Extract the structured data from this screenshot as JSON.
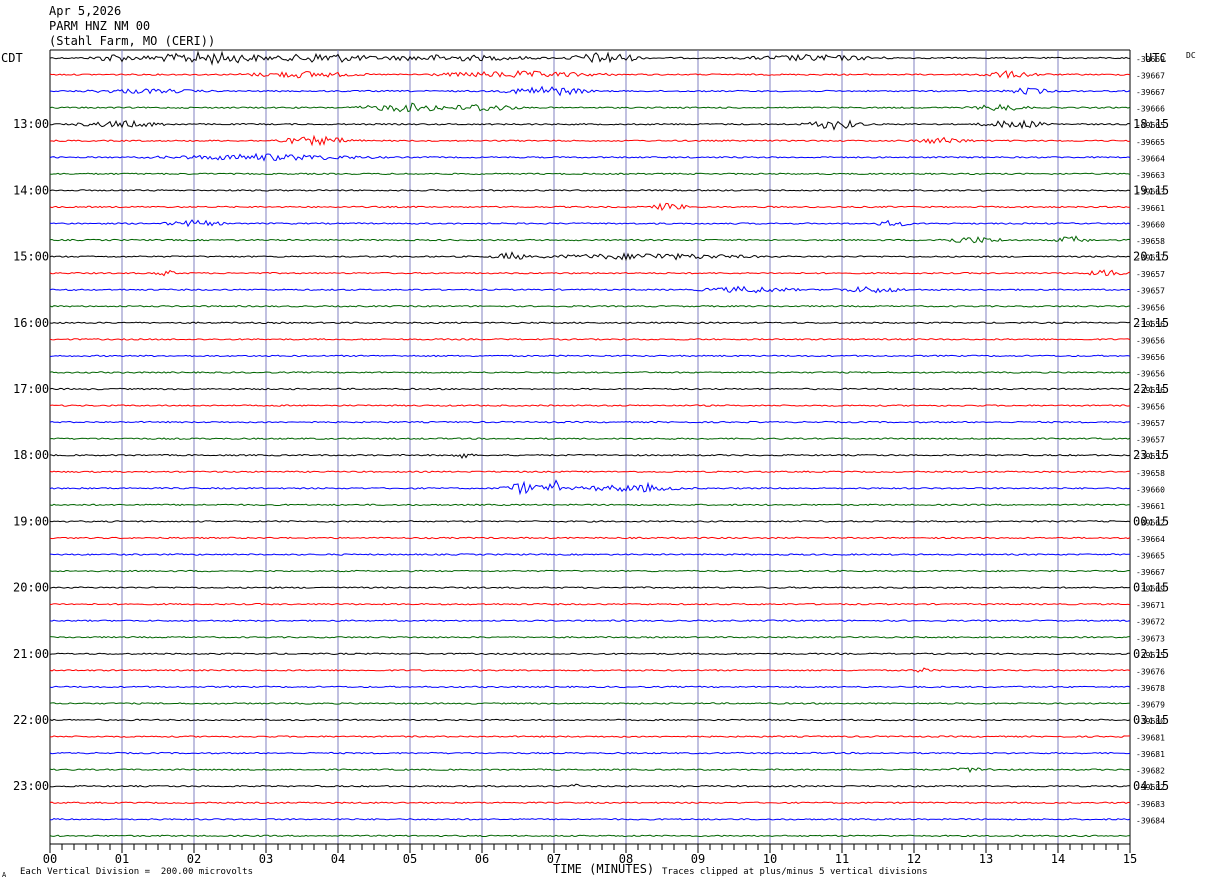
{
  "header": {
    "date": "Apr 5,2026",
    "station": "PARM HNZ NM 00",
    "location": "(Stahl Farm, MO (CERI))"
  },
  "chart_data": {
    "type": "line",
    "title": "PARM HNZ NM 00",
    "subtitle": "(Stahl Farm, MO (CERI))",
    "date": "Apr 5,2026",
    "left_timezone": "CDT",
    "right_timezone": "UTC",
    "dc_label": "DC",
    "xlabel": "TIME (MINUTES)",
    "x_ticks": [
      "00",
      "01",
      "02",
      "03",
      "04",
      "05",
      "06",
      "07",
      "08",
      "09",
      "10",
      "11",
      "12",
      "13",
      "14",
      "15"
    ],
    "xlim": [
      0,
      15
    ],
    "row_minutes": 15,
    "trace_count": 48,
    "left_hour_labels": [
      "13:00",
      "14:00",
      "15:00",
      "16:00",
      "17:00",
      "18:00",
      "19:00",
      "20:00",
      "21:00",
      "22:00",
      "23:00"
    ],
    "right_hour_labels": [
      "18:15",
      "19:15",
      "20:15",
      "21:15",
      "22:15",
      "23:15",
      "00:15",
      "01:15",
      "02:15",
      "03:15",
      "04:15"
    ],
    "trace_colors": [
      "#000000",
      "#ff0000",
      "#0000ff",
      "#006400"
    ],
    "grid_color": "#8080c0",
    "dc_offsets": [
      "-39669",
      "-39667",
      "-39667",
      "-39666",
      "-39665",
      "-39665",
      "-39664",
      "-39663",
      "-39663",
      "-39661",
      "-39660",
      "-39658",
      "-39657",
      "-39657",
      "-39657",
      "-39656",
      "-39656",
      "-39656",
      "-39656",
      "-39656",
      "-39656",
      "-39656",
      "-39657",
      "-39657",
      "-39657",
      "-39658",
      "-39660",
      "-39661",
      "-39662",
      "-39664",
      "-39665",
      "-39667",
      "-39669",
      "-39671",
      "-39672",
      "-39673",
      "-39675",
      "-39676",
      "-39678",
      "-39679",
      "-39680",
      "-39681",
      "-39681",
      "-39682",
      "-39682",
      "-39683",
      "-39684"
    ],
    "events": [
      {
        "trace": 0,
        "minute": 0.9,
        "amp": 4,
        "dur": 0.4
      },
      {
        "trace": 0,
        "minute": 2.2,
        "amp": 6,
        "dur": 1.2
      },
      {
        "trace": 0,
        "minute": 3.8,
        "amp": 5,
        "dur": 0.9
      },
      {
        "trace": 0,
        "minute": 7.7,
        "amp": 6,
        "dur": 0.6
      },
      {
        "trace": 0,
        "minute": 10.6,
        "amp": 3,
        "dur": 1.2
      },
      {
        "trace": 0,
        "minute": 5.5,
        "amp": 3,
        "dur": 1.5
      },
      {
        "trace": 1,
        "minute": 3.5,
        "amp": 3,
        "dur": 1.0
      },
      {
        "trace": 1,
        "minute": 6.5,
        "amp": 3,
        "dur": 1.5
      },
      {
        "trace": 1,
        "minute": 13.3,
        "amp": 3,
        "dur": 0.6
      },
      {
        "trace": 2,
        "minute": 6.9,
        "amp": 5,
        "dur": 0.7
      },
      {
        "trace": 2,
        "minute": 1.3,
        "amp": 2,
        "dur": 1.0
      },
      {
        "trace": 2,
        "minute": 13.6,
        "amp": 3,
        "dur": 0.4
      },
      {
        "trace": 3,
        "minute": 5.0,
        "amp": 4,
        "dur": 0.9
      },
      {
        "trace": 3,
        "minute": 6.0,
        "amp": 4,
        "dur": 0.6
      },
      {
        "trace": 3,
        "minute": 13.2,
        "amp": 3,
        "dur": 0.5
      },
      {
        "trace": 4,
        "minute": 1.0,
        "amp": 3,
        "dur": 0.8
      },
      {
        "trace": 4,
        "minute": 10.9,
        "amp": 5,
        "dur": 0.5
      },
      {
        "trace": 4,
        "minute": 13.4,
        "amp": 4,
        "dur": 0.6
      },
      {
        "trace": 5,
        "minute": 3.7,
        "amp": 4,
        "dur": 0.7
      },
      {
        "trace": 5,
        "minute": 12.4,
        "amp": 3,
        "dur": 0.5
      },
      {
        "trace": 6,
        "minute": 3.0,
        "amp": 3,
        "dur": 1.8
      },
      {
        "trace": 9,
        "minute": 8.6,
        "amp": 4,
        "dur": 0.3
      },
      {
        "trace": 10,
        "minute": 2.0,
        "amp": 3,
        "dur": 0.5
      },
      {
        "trace": 10,
        "minute": 11.7,
        "amp": 3,
        "dur": 0.3
      },
      {
        "trace": 11,
        "minute": 12.8,
        "amp": 3,
        "dur": 0.6
      },
      {
        "trace": 11,
        "minute": 14.2,
        "amp": 4,
        "dur": 0.3
      },
      {
        "trace": 12,
        "minute": 6.4,
        "amp": 4,
        "dur": 0.3
      },
      {
        "trace": 12,
        "minute": 8.3,
        "amp": 3,
        "dur": 1.8
      },
      {
        "trace": 13,
        "minute": 1.6,
        "amp": 3,
        "dur": 0.2
      },
      {
        "trace": 13,
        "minute": 14.7,
        "amp": 3,
        "dur": 0.4
      },
      {
        "trace": 14,
        "minute": 9.7,
        "amp": 3,
        "dur": 0.8
      },
      {
        "trace": 14,
        "minute": 11.4,
        "amp": 3,
        "dur": 0.6
      },
      {
        "trace": 24,
        "minute": 5.7,
        "amp": 3,
        "dur": 0.2
      },
      {
        "trace": 26,
        "minute": 6.6,
        "amp": 6,
        "dur": 0.4
      },
      {
        "trace": 26,
        "minute": 7.0,
        "amp": 10,
        "dur": 0.1
      },
      {
        "trace": 26,
        "minute": 8.0,
        "amp": 3,
        "dur": 1.0
      },
      {
        "trace": 26,
        "minute": 8.3,
        "amp": 6,
        "dur": 0.1
      },
      {
        "trace": 37,
        "minute": 12.1,
        "amp": 2,
        "dur": 0.2
      },
      {
        "trace": 43,
        "minute": 12.8,
        "amp": 2,
        "dur": 0.4
      },
      {
        "trace": 44,
        "minute": 7.3,
        "amp": 2,
        "dur": 0.1
      }
    ],
    "footer_left": "Each Vertical Division =  200.00 microvolts",
    "footer_right": "Traces clipped at plus/minus 5 vertical divisions",
    "footer_mark": "A"
  }
}
